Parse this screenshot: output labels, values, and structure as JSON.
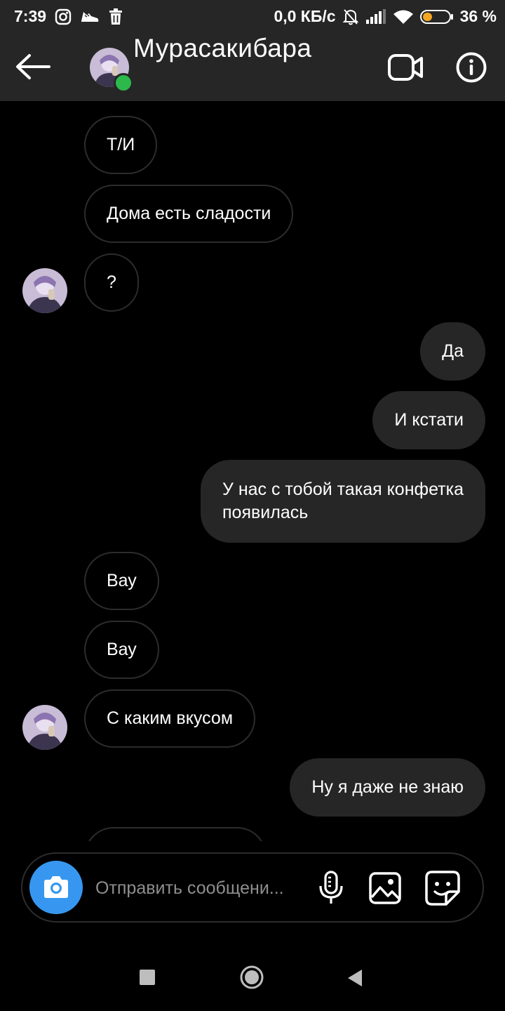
{
  "status_bar": {
    "time": "7:39",
    "network_speed": "0,0 КБ/с",
    "battery_percent": "36 %",
    "left_icons": [
      "instagram-icon",
      "sneaker-icon",
      "trash-icon"
    ],
    "right_icons": [
      "bell-off-icon",
      "signal-icon",
      "wifi-icon",
      "battery-icon"
    ],
    "battery_level": 0.36
  },
  "header": {
    "contact_name": "Мурасакибара",
    "online_color": "#2db84b",
    "icons": [
      "back-arrow-icon",
      "avatar",
      "video-call-icon",
      "info-icon"
    ]
  },
  "messages": [
    {
      "side": "in",
      "text": "Т/И"
    },
    {
      "side": "in",
      "text": "Дома есть сладости"
    },
    {
      "side": "in",
      "text": "?",
      "avatar": true
    },
    {
      "side": "out",
      "text": "Да"
    },
    {
      "side": "out",
      "text": "И кстати"
    },
    {
      "side": "out",
      "lines": [
        "У нас с тобой такая конфетка",
        "появилась"
      ]
    },
    {
      "side": "in",
      "text": "Вау"
    },
    {
      "side": "in",
      "text": "Вау"
    },
    {
      "side": "in",
      "text": "С каким вкусом",
      "avatar": true
    },
    {
      "side": "out",
      "text": "Ну я даже не знаю"
    }
  ],
  "composer": {
    "placeholder": "Отправить сообщени...",
    "camera_color": "#3797f0",
    "icons": [
      "camera-icon",
      "microphone-icon",
      "gallery-icon",
      "sticker-icon"
    ]
  },
  "nav_bar": {
    "icons": [
      "recents-square-icon",
      "home-circle-icon",
      "back-triangle-icon"
    ]
  },
  "colors": {
    "bar_bg": "#262626",
    "outgoing_bubble": "#262626",
    "incoming_border": "#2c2c2c",
    "accent_blue": "#3797f0"
  }
}
